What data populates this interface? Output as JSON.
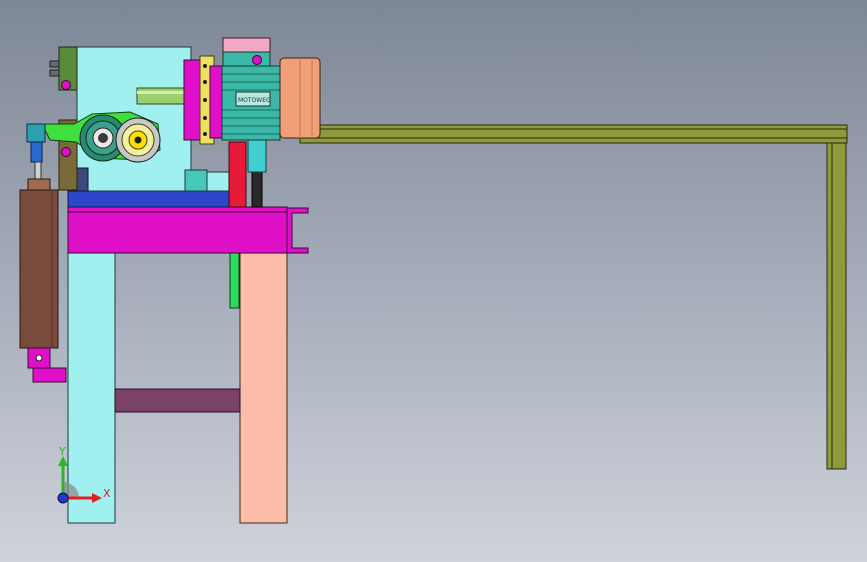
{
  "viewport": {
    "background_top": "#7e8796",
    "background_bottom": "#cfd2da"
  },
  "motor": {
    "nameplate_text": "MOTOWEG"
  },
  "triad": {
    "x_label": "X",
    "y_label": "Y",
    "x_color": "#e02020",
    "y_color": "#2bb52b",
    "z_color": "#2038d0"
  },
  "colors": {
    "frame_cyan": "#9ff0ee",
    "table_magenta": "#e010c8",
    "leg_salmon": "#fbbcaa",
    "rail_olive": "#8f9a3a",
    "motor_copper": "#f0a078",
    "motor_teal": "#3cb8a8",
    "cylinder_brown": "#7a4a3c",
    "base_blue": "#2c48c8",
    "crossbar_purple": "#7a4266"
  }
}
